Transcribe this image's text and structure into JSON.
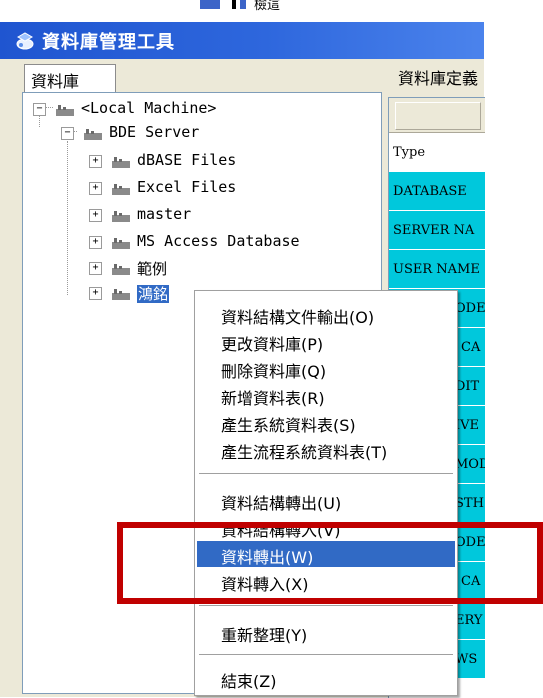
{
  "top_strip": {
    "cut_text": "檢這"
  },
  "window": {
    "title": "資料庫管理工具",
    "title_icon": "database-tool-icon"
  },
  "tabs": [
    {
      "label": "資料庫"
    }
  ],
  "right_panel": {
    "header": "資料庫定義",
    "rows": [
      "Type",
      "DATABASE",
      "SERVER NA",
      "USER NAME",
      "ODE",
      "CA",
      "DIT",
      "IVE",
      "MOD",
      "STH",
      "ODE",
      "CA",
      "ERY",
      "WS"
    ]
  },
  "tree": {
    "root": "<Local Machine>",
    "bde": "BDE Server",
    "children": [
      "dBASE Files",
      "Excel Files",
      "master",
      "MS Access Database",
      "範例",
      "鴻銘"
    ],
    "selected": "鴻銘"
  },
  "context_menu": {
    "items": [
      "資料結構文件輸出(O)",
      "更改資料庫(P)",
      "刪除資料庫(Q)",
      "新增資料表(R)",
      "產生系統資料表(S)",
      "產生流程系統資料表(T)",
      "資料結構轉出(U)",
      "資料結構轉入(V)",
      "資料轉出(W)",
      "資料轉入(X)",
      "重新整理(Y)",
      "結束(Z)"
    ],
    "highlighted": "資料轉出(W)"
  },
  "colors": {
    "title_bar": "#1f55d0",
    "selection": "#316ac5",
    "grid_cell": "#00c8dc",
    "annotation": "#c00000"
  }
}
